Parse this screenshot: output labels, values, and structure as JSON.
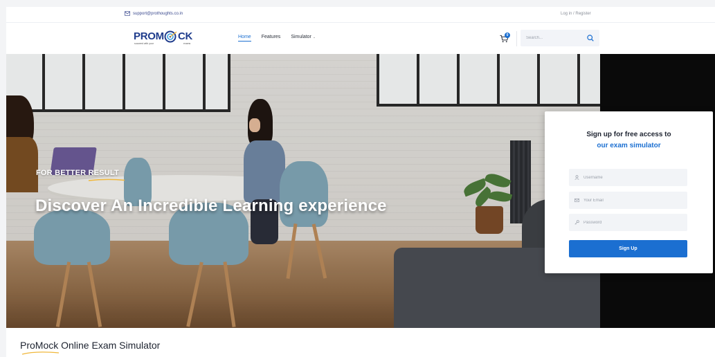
{
  "topbar": {
    "email": "support@prothoughts.co.in",
    "login": "Log in",
    "separator": "/",
    "register": "Register"
  },
  "brand": {
    "logo_part1": "PROM",
    "logo_part2": "CK",
    "tagline_left": "succeed with your",
    "tagline_right": "exams"
  },
  "nav": {
    "items": [
      {
        "label": "Home",
        "active": true
      },
      {
        "label": "Features",
        "active": false
      },
      {
        "label": "Simulator",
        "active": false
      }
    ],
    "cart_count": "0",
    "search_placeholder": "Search..."
  },
  "hero": {
    "eyebrow": "FOR BETTER RESULT",
    "headline": "Discover An Incredible Learning experience"
  },
  "signup": {
    "title_line1": "Sign up for free access to",
    "title_line2": "our exam simulator",
    "username_placeholder": "Username",
    "email_placeholder": "Your Email",
    "password_placeholder": "Password",
    "button_label": "Sign Up"
  },
  "section": {
    "title": "ProMock Online Exam Simulator"
  },
  "colors": {
    "primary": "#1b6fd1",
    "brand_navy": "#1f3c8c",
    "accent_underline": "#f0b73a"
  }
}
